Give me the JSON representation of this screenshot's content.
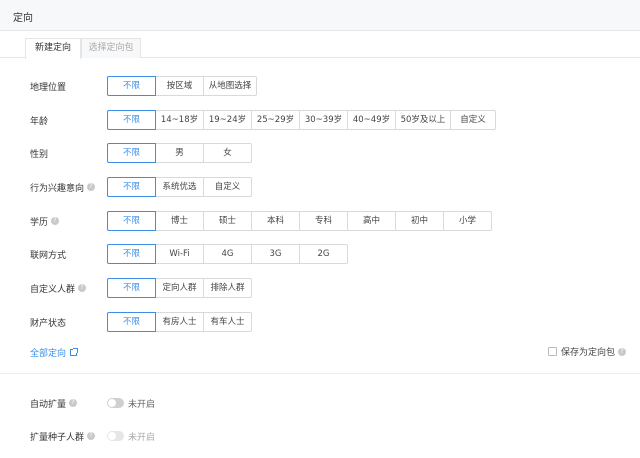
{
  "header": {
    "title": "定向"
  },
  "tabs": [
    {
      "label": "新建定向",
      "active": true
    },
    {
      "label": "选择定向包",
      "active": false
    }
  ],
  "rows": {
    "location": {
      "label": "地理位置",
      "options": [
        "不限",
        "按区域",
        "从地图选择"
      ],
      "selected": 0
    },
    "age": {
      "label": "年龄",
      "options": [
        "不限",
        "14~18岁",
        "19~24岁",
        "25~29岁",
        "30~39岁",
        "40~49岁",
        "50岁及以上",
        "自定义"
      ],
      "selected": 0
    },
    "gender": {
      "label": "性别",
      "options": [
        "不限",
        "男",
        "女"
      ],
      "selected": 0
    },
    "interest": {
      "label": "行为兴趣意向",
      "options": [
        "不限",
        "系统优选",
        "自定义"
      ],
      "selected": 0
    },
    "education": {
      "label": "学历",
      "options": [
        "不限",
        "博士",
        "硕士",
        "本科",
        "专科",
        "高中",
        "初中",
        "小学"
      ],
      "selected": 0
    },
    "network": {
      "label": "联网方式",
      "options": [
        "不限",
        "Wi-Fi",
        "4G",
        "3G",
        "2G"
      ],
      "selected": 0
    },
    "custom_audience": {
      "label": "自定义人群",
      "options": [
        "不限",
        "定向人群",
        "排除人群"
      ],
      "selected": 0
    },
    "assets": {
      "label": "财产状态",
      "options": [
        "不限",
        "有房人士",
        "有车人士"
      ],
      "selected": 0
    }
  },
  "all_targeting_link": "全部定向",
  "save_as_package": "保存为定向包",
  "auto_expand": {
    "label": "自动扩量",
    "status": "未开启"
  },
  "seed_audience": {
    "label": "扩量种子人群",
    "status": "未开启"
  },
  "colors": {
    "accent": "#3a8ee6",
    "border": "#d9d9d9",
    "header_bg": "#f7f8fa"
  }
}
